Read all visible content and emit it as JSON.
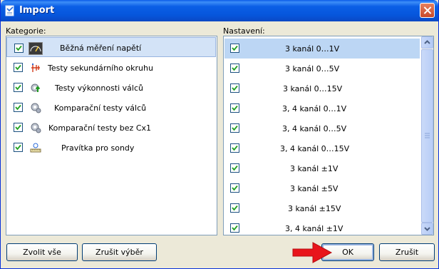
{
  "window": {
    "title": "Import"
  },
  "left": {
    "label": "Kategorie:",
    "items": [
      {
        "label": "Běžná měření napětí",
        "checked": true,
        "icon": "meter-icon"
      },
      {
        "label": "Testy sekundárního okruhu",
        "checked": true,
        "icon": "circuit-icon"
      },
      {
        "label": "Testy výkonnosti válců",
        "checked": true,
        "icon": "gear-up-icon"
      },
      {
        "label": "Komparační testy válců",
        "checked": true,
        "icon": "gear-icon"
      },
      {
        "label": "Komparační testy bez Cx1",
        "checked": true,
        "icon": "gear-icon"
      },
      {
        "label": "Pravítka pro sondy",
        "checked": true,
        "icon": "ruler-icon"
      }
    ]
  },
  "right": {
    "label": "Nastavení:",
    "items": [
      {
        "label": "3 kanál 0…1V",
        "checked": true
      },
      {
        "label": "3 kanál 0…5V",
        "checked": true
      },
      {
        "label": "3 kanál 0…15V",
        "checked": true
      },
      {
        "label": "3, 4 kanál 0…1V",
        "checked": true
      },
      {
        "label": "3, 4 kanál 0…5V",
        "checked": true
      },
      {
        "label": "3, 4 kanál 0…15V",
        "checked": true
      },
      {
        "label": "3 kanál ±1V",
        "checked": true
      },
      {
        "label": "3 kanál ±5V",
        "checked": true
      },
      {
        "label": "3 kanál ±15V",
        "checked": true
      },
      {
        "label": "3, 4 kanál ±1V",
        "checked": true
      }
    ]
  },
  "buttons": {
    "select_all": "Zvolit vše",
    "clear_selection": "Zrušit výběr",
    "ok": "OK",
    "cancel": "Zrušit"
  },
  "colors": {
    "arrow": "#e8141b",
    "title_bar": "#0656dc"
  }
}
